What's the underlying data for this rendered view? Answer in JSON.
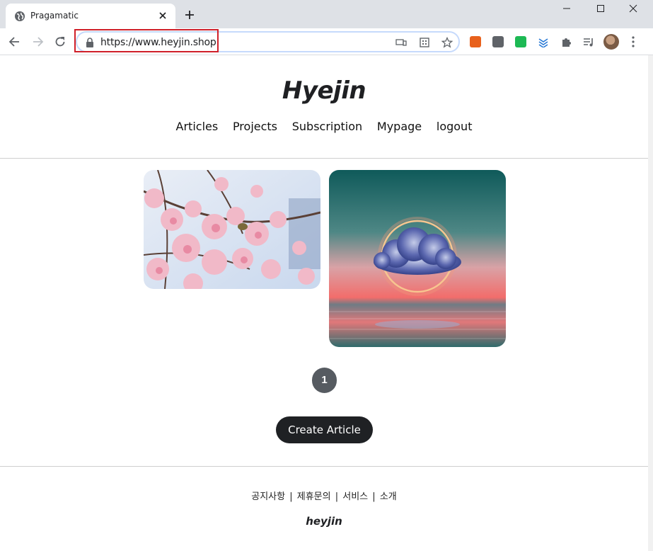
{
  "browser": {
    "tab_title": "Pragamatic",
    "url": "https://www.heyjin.shop"
  },
  "site": {
    "logo": "Hyejin",
    "nav": [
      "Articles",
      "Projects",
      "Subscription",
      "Mypage",
      "logout"
    ]
  },
  "articles": [
    {
      "image": "cherry-blossom-photo"
    },
    {
      "image": "cloud-ring-sunset-photo"
    }
  ],
  "pagination": {
    "current_page": "1"
  },
  "create_button": "Create Article",
  "footer": {
    "links": [
      "공지사항",
      "제휴문의",
      "서비스",
      "소개"
    ],
    "separator": "|",
    "logo": "heyjin"
  },
  "colors": {
    "highlight_box": "#d0202a",
    "page_button": "#565b61",
    "create_button": "#1f2124"
  }
}
